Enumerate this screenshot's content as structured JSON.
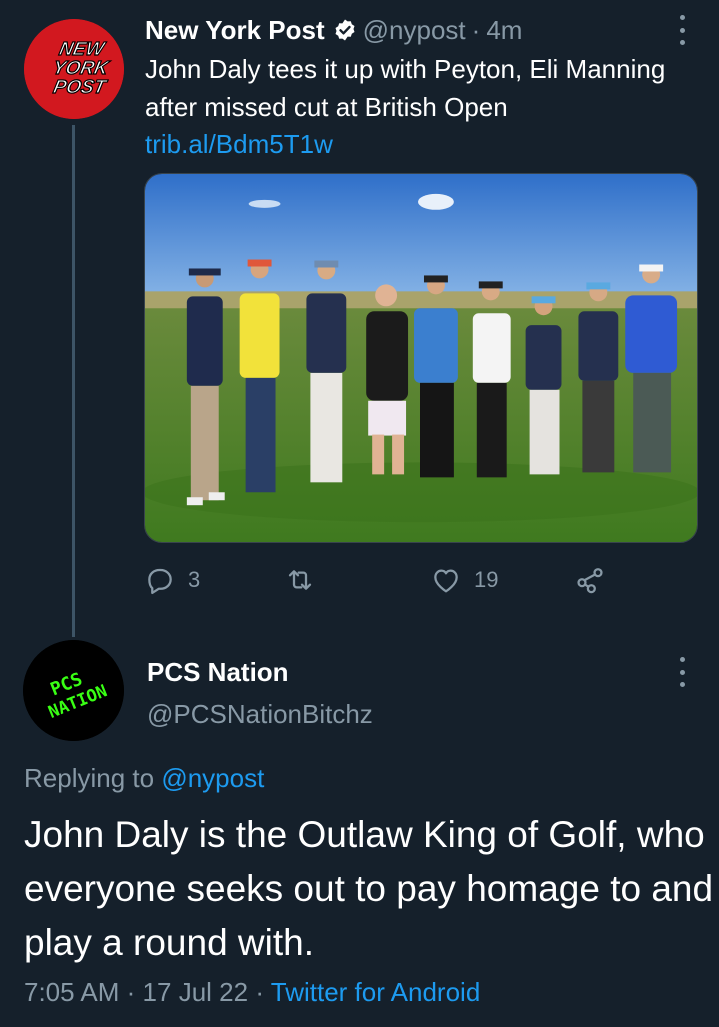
{
  "tweet": {
    "author_name": "New York Post",
    "author_handle": "@nypost",
    "separator": "·",
    "time_ago": "4m",
    "avatar_text": [
      "NEW",
      "YORK",
      "POST"
    ],
    "text": "John Daly tees it up with Peyton, Eli Manning after missed cut at British Open",
    "link": "trib.al/Bdm5T1w",
    "stats": {
      "replies": "3",
      "retweets": "",
      "likes": "19"
    }
  },
  "reply": {
    "author_name": "PCS Nation",
    "author_handle": "@PCSNationBitchz",
    "avatar_text": [
      "PCS",
      "NATION"
    ],
    "replying_to_label": "Replying to",
    "replying_to_handle": "@nypost",
    "text": "John Daly is the Outlaw King of Golf, who everyone seeks out to pay homage to and play a round with.",
    "time": "7:05 AM",
    "date": "17 Jul 22",
    "separator": "·",
    "source": "Twitter for Android"
  },
  "icons": {
    "verified": "verified-badge-icon",
    "more": "more-options-icon",
    "reply": "comment-icon",
    "retweet": "retweet-icon",
    "like": "heart-icon",
    "share": "share-icon"
  },
  "colors": {
    "background": "#15202b",
    "accent": "#1d9bf0",
    "secondary_text": "#8899a6",
    "nyp_red": "#d2181f",
    "pcs_green": "#39ff14"
  }
}
